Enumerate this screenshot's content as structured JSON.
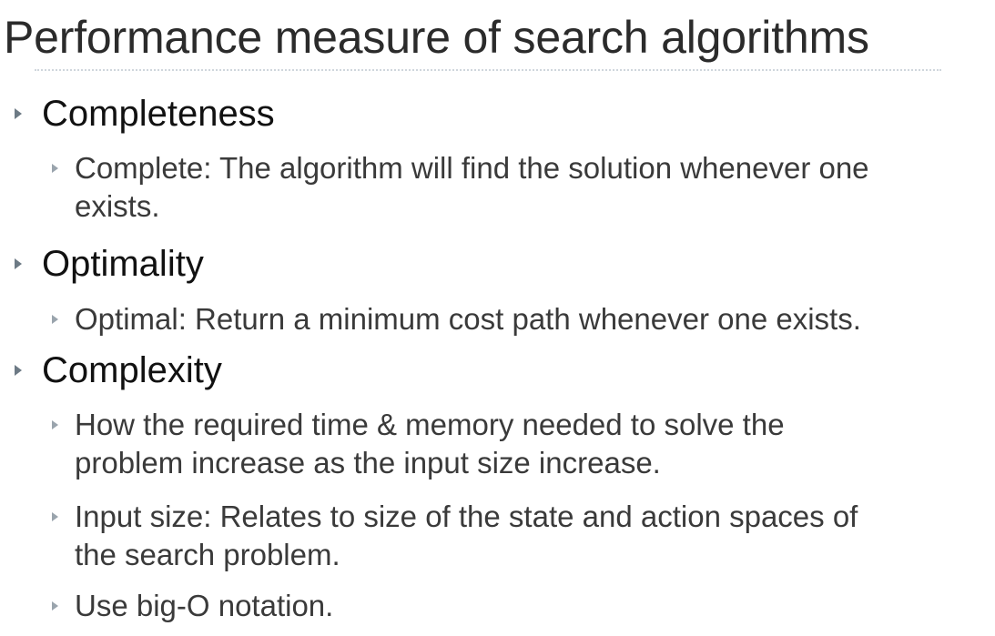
{
  "title": "Performance measure of search algorithms",
  "sections": [
    {
      "heading": "Completeness",
      "items": [
        {
          "line1": "Complete: The algorithm will find the solution whenever one",
          "line2": "exists."
        }
      ]
    },
    {
      "heading": "Optimality",
      "items": [
        {
          "line1": "Optimal: Return a minimum cost path whenever one exists.",
          "line2": ""
        }
      ]
    },
    {
      "heading": "Complexity",
      "items": [
        {
          "line1": "How the required time & memory needed to solve the",
          "line2": "problem increase as the input size increase."
        },
        {
          "line1": "Input size: Relates to size of the state and action spaces of",
          "line2": "the search problem."
        },
        {
          "line1": "Use big-O notation.",
          "line2": ""
        }
      ]
    }
  ],
  "icons": {
    "bullet": "triangle-right-icon",
    "color_level1": "#6d7a85",
    "color_level2": "#9aa4ad"
  }
}
